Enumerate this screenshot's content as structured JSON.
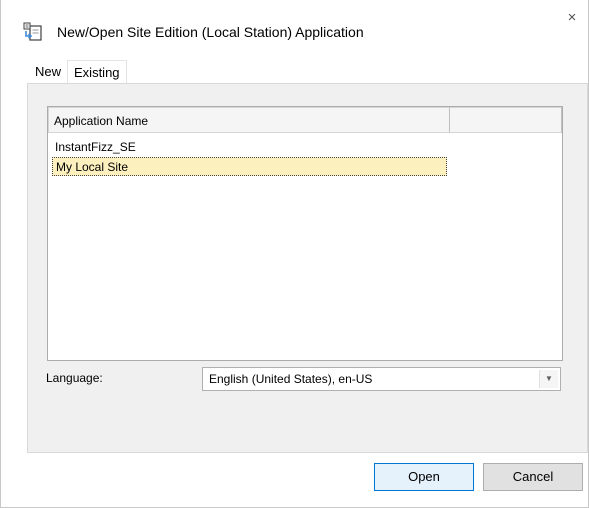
{
  "window": {
    "title": "New/Open Site Edition (Local Station) Application",
    "close_glyph": "×",
    "icon": "app-open-icon"
  },
  "tabs": [
    {
      "label": "New",
      "active": false
    },
    {
      "label": "Existing",
      "active": true
    }
  ],
  "list": {
    "columns": [
      "Application Name",
      ""
    ],
    "rows": [
      {
        "name": "InstantFizz_SE",
        "selected": false
      },
      {
        "name": "My Local Site",
        "selected": true
      }
    ]
  },
  "language": {
    "label": "Language:",
    "value": "English (United States), en-US",
    "arrow_glyph": "▼"
  },
  "buttons": {
    "open": "Open",
    "cancel": "Cancel"
  },
  "colors": {
    "selection": "#fdf0bf",
    "panel": "#f0f0f0",
    "accent": "#0078d7"
  }
}
